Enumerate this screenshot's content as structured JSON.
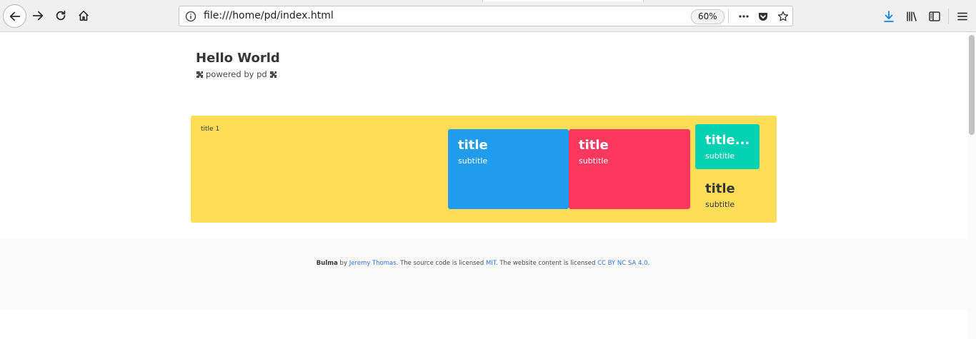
{
  "browser": {
    "url": "file:///home/pd/index.html",
    "zoom": "60%",
    "icons": {
      "back": "back-arrow-icon",
      "forward": "forward-arrow-icon",
      "reload": "reload-icon",
      "home": "home-icon",
      "info": "info-icon",
      "more": "more-dots-icon",
      "pocket": "pocket-icon",
      "bookmark": "star-icon",
      "download": "download-icon",
      "library": "library-icon",
      "sidebar": "sidebar-icon",
      "menu": "hamburger-menu-icon"
    },
    "download_color": "#0a84ff"
  },
  "hero": {
    "title": "Hello World",
    "subtitle": "powered by pd"
  },
  "tiles": {
    "container_title": "title 1",
    "blue": {
      "title": "title",
      "subtitle": "subtitle"
    },
    "red": {
      "title": "title",
      "subtitle": "subtitle"
    },
    "teal": {
      "title": "title...",
      "subtitle": "subtitle"
    },
    "plain": {
      "title": "title",
      "subtitle": "subtitle"
    }
  },
  "footer": {
    "brand": "Bulma",
    "by": "by",
    "author": "Jeremy Thomas",
    "text1": ". The source code is licensed",
    "license_code": "MIT",
    "text2": ". The website content is licensed",
    "license_content": "CC BY NC SA 4.0",
    "text3": "."
  },
  "colors": {
    "warning": "#ffdd57",
    "info": "#209cee",
    "danger": "#ff3860",
    "primary": "#00d1b2",
    "link": "#3273dc"
  }
}
